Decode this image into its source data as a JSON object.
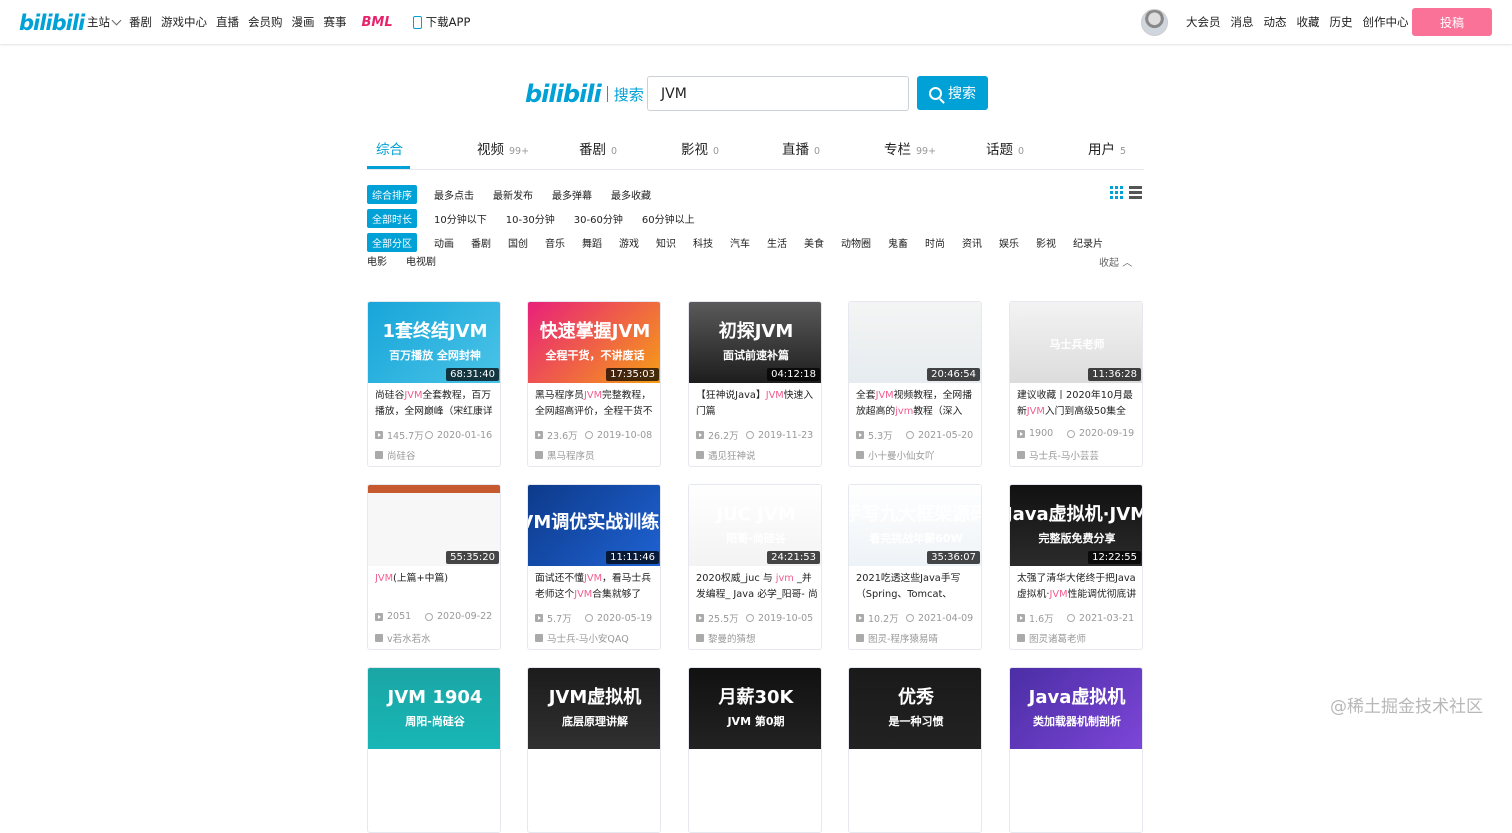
{
  "header": {
    "logo": "bilibili",
    "nav_left": [
      "主站",
      "番剧",
      "游戏中心",
      "直播",
      "会员购",
      "漫画",
      "赛事"
    ],
    "bml": "BML",
    "download_app": "下载APP",
    "nav_right": [
      "大会员",
      "消息",
      "动态",
      "收藏",
      "历史",
      "创作中心"
    ],
    "upload": "投稿"
  },
  "search": {
    "logo": "bilibili",
    "logo_suffix": "搜索",
    "query": "JVM",
    "button": "搜索"
  },
  "tabs": [
    {
      "label": "综合",
      "count": ""
    },
    {
      "label": "视频",
      "count": "99+"
    },
    {
      "label": "番剧",
      "count": "0"
    },
    {
      "label": "影视",
      "count": "0"
    },
    {
      "label": "直播",
      "count": "0"
    },
    {
      "label": "专栏",
      "count": "99+"
    },
    {
      "label": "话题",
      "count": "0"
    },
    {
      "label": "用户",
      "count": "5"
    }
  ],
  "filters": {
    "order": [
      "综合排序",
      "最多点击",
      "最新发布",
      "最多弹幕",
      "最多收藏"
    ],
    "duration": [
      "全部时长",
      "10分钟以下",
      "10-30分钟",
      "30-60分钟",
      "60分钟以上"
    ],
    "zone": [
      "全部分区",
      "动画",
      "番剧",
      "国创",
      "音乐",
      "舞蹈",
      "游戏",
      "知识",
      "科技",
      "汽车",
      "生活",
      "美食",
      "动物圈",
      "鬼畜",
      "时尚",
      "资讯",
      "娱乐",
      "影视",
      "纪录片"
    ],
    "zone_row2": [
      "电影",
      "电视剧"
    ],
    "collapse": "收起"
  },
  "cards": [
    {
      "thumb1": "1套终结JVM",
      "thumb2": "百万播放 全网封神",
      "duration": "68:31:40",
      "title": [
        [
          "尚硅谷",
          ""
        ],
        [
          "JVM",
          "hl"
        ],
        [
          "全套教程，百万播放，全网巅峰（宋红康详",
          ""
        ]
      ],
      "plays": "145.7万",
      "date": "2020-01-16",
      "uploader": "尚硅谷",
      "bg": "linear-gradient(135deg,#17a5d8,#4bc4e8)"
    },
    {
      "thumb1": "快速掌握JVM",
      "thumb2": "全程干货，不讲废话",
      "duration": "17:35:03",
      "title": [
        [
          "黑马程序员",
          ""
        ],
        [
          "JVM",
          "hl"
        ],
        [
          "完整教程，全网超高评价，全程干货不",
          ""
        ]
      ],
      "plays": "23.6万",
      "date": "2019-10-08",
      "uploader": "黑马程序员",
      "bg": "linear-gradient(135deg,#e8207a,#f6a014)"
    },
    {
      "thumb1": "初探JVM",
      "thumb2": "面试前速补篇",
      "duration": "04:12:18",
      "title": [
        [
          "【狂神说Java】",
          ""
        ],
        [
          "JVM",
          "hl"
        ],
        [
          "快速入门篇",
          ""
        ]
      ],
      "plays": "26.2万",
      "date": "2019-11-23",
      "uploader": "遇见狂神说",
      "bg": "linear-gradient(180deg,#5a5a5a,#1d1d1d)"
    },
    {
      "thumb1": "",
      "thumb2": "",
      "duration": "20:46:54",
      "title": [
        [
          "全套",
          ""
        ],
        [
          "JVM",
          "hl"
        ],
        [
          "视频教程，全网播放超高的",
          ""
        ],
        [
          "jvm",
          "hl"
        ],
        [
          "教程（深入",
          ""
        ]
      ],
      "plays": "5.3万",
      "date": "2021-05-20",
      "uploader": "小十曼小仙女吖",
      "bg": "linear-gradient(180deg,#f4f4f4,#e6ecef)"
    },
    {
      "thumb1": "",
      "thumb2": "马士兵老师",
      "duration": "11:36:28",
      "title": [
        [
          "建议收藏丨2020年10月最新",
          ""
        ],
        [
          "JVM",
          "hl"
        ],
        [
          "入门到高级50集全",
          ""
        ]
      ],
      "plays": "1900",
      "date": "2020-09-19",
      "uploader": "马士兵-马小芸芸",
      "bg": "linear-gradient(180deg,#f3f3f3,#dcdcdc)"
    },
    {
      "thumb1": "",
      "thumb2": "",
      "duration": "55:35:20",
      "title": [
        [
          "JVM",
          "hl"
        ],
        [
          "(上篇+中篇)",
          ""
        ]
      ],
      "plays": "2051",
      "date": "2020-09-22",
      "uploader": "v若水若水",
      "bg": "linear-gradient(180deg,#c65a2e 0 10%,#f7f7f7 10%)"
    },
    {
      "thumb1": "JVM调优实战训练营",
      "thumb2": "",
      "duration": "11:11:46",
      "title": [
        [
          "面试还不懂",
          ""
        ],
        [
          "JVM",
          "hl"
        ],
        [
          "，看马士兵老师这个",
          ""
        ],
        [
          "JVM",
          "hl"
        ],
        [
          "合集就够了",
          ""
        ]
      ],
      "plays": "5.7万",
      "date": "2020-05-19",
      "uploader": "马士兵-马小安QAQ",
      "bg": "linear-gradient(135deg,#0d3a8a,#1f63d4)"
    },
    {
      "thumb1": "JUC JVM",
      "thumb2": "阳哥-尚硅谷",
      "duration": "24:21:53",
      "title": [
        [
          "2020权威_juc 与 ",
          ""
        ],
        [
          "jvm",
          "hl"
        ],
        [
          " _并发编程_ Java 必学_阳哥- 尚",
          ""
        ]
      ],
      "plays": "25.5万",
      "date": "2019-10-05",
      "uploader": "黎曼的猜想",
      "bg": "linear-gradient(180deg,#ffffff,#f3f3f3)"
    },
    {
      "thumb1": "手写九大框架源码",
      "thumb2": "看完挑战年薪60W",
      "duration": "35:36:07",
      "title": [
        [
          "2021吃透这些Java手写（Spring、Tomcat、",
          ""
        ]
      ],
      "plays": "10.2万",
      "date": "2021-04-09",
      "uploader": "图灵-程序猿易晴",
      "bg": "linear-gradient(180deg,#ffffff,#eef3f7)"
    },
    {
      "thumb1": "Java虚拟机·JVM",
      "thumb2": "完整版免费分享",
      "duration": "12:22:55",
      "title": [
        [
          "太强了清华大佬终于把Java虚拟机·",
          ""
        ],
        [
          "JVM",
          "hl"
        ],
        [
          "性能调优彻底讲",
          ""
        ]
      ],
      "plays": "1.6万",
      "date": "2021-03-21",
      "uploader": "图灵诸葛老师",
      "bg": "linear-gradient(180deg,#111,#2b2b2b)"
    },
    {
      "thumb1": "JVM 1904",
      "thumb2": "周阳-尚硅谷",
      "duration": "",
      "title": [],
      "plays": "",
      "date": "",
      "uploader": "",
      "bg": "linear-gradient(180deg,#1aa6a5,#18b6b6)"
    },
    {
      "thumb1": "JVM虚拟机",
      "thumb2": "底层原理讲解",
      "duration": "",
      "title": [],
      "plays": "",
      "date": "",
      "uploader": "",
      "bg": "linear-gradient(180deg,#1c1c1c,#303030)"
    },
    {
      "thumb1": "月薪30K",
      "thumb2": "JVM 第0期",
      "duration": "",
      "title": [],
      "plays": "",
      "date": "",
      "uploader": "",
      "bg": "linear-gradient(180deg,#111,#222)"
    },
    {
      "thumb1": "优秀",
      "thumb2": "是一种习惯",
      "duration": "",
      "title": [],
      "plays": "",
      "date": "",
      "uploader": "",
      "bg": "linear-gradient(180deg,#1a1a1a,#222)"
    },
    {
      "thumb1": "Java虚拟机",
      "thumb2": "类加载器机制剖析",
      "duration": "",
      "title": [],
      "plays": "",
      "date": "",
      "uploader": "",
      "bg": "linear-gradient(135deg,#4b2ea5,#7d46d8)"
    }
  ],
  "watermark": "@稀土掘金技术社区",
  "colors": {
    "accent": "#00a1d6",
    "pink": "#fb7299",
    "highlight": "#f25d8e"
  }
}
